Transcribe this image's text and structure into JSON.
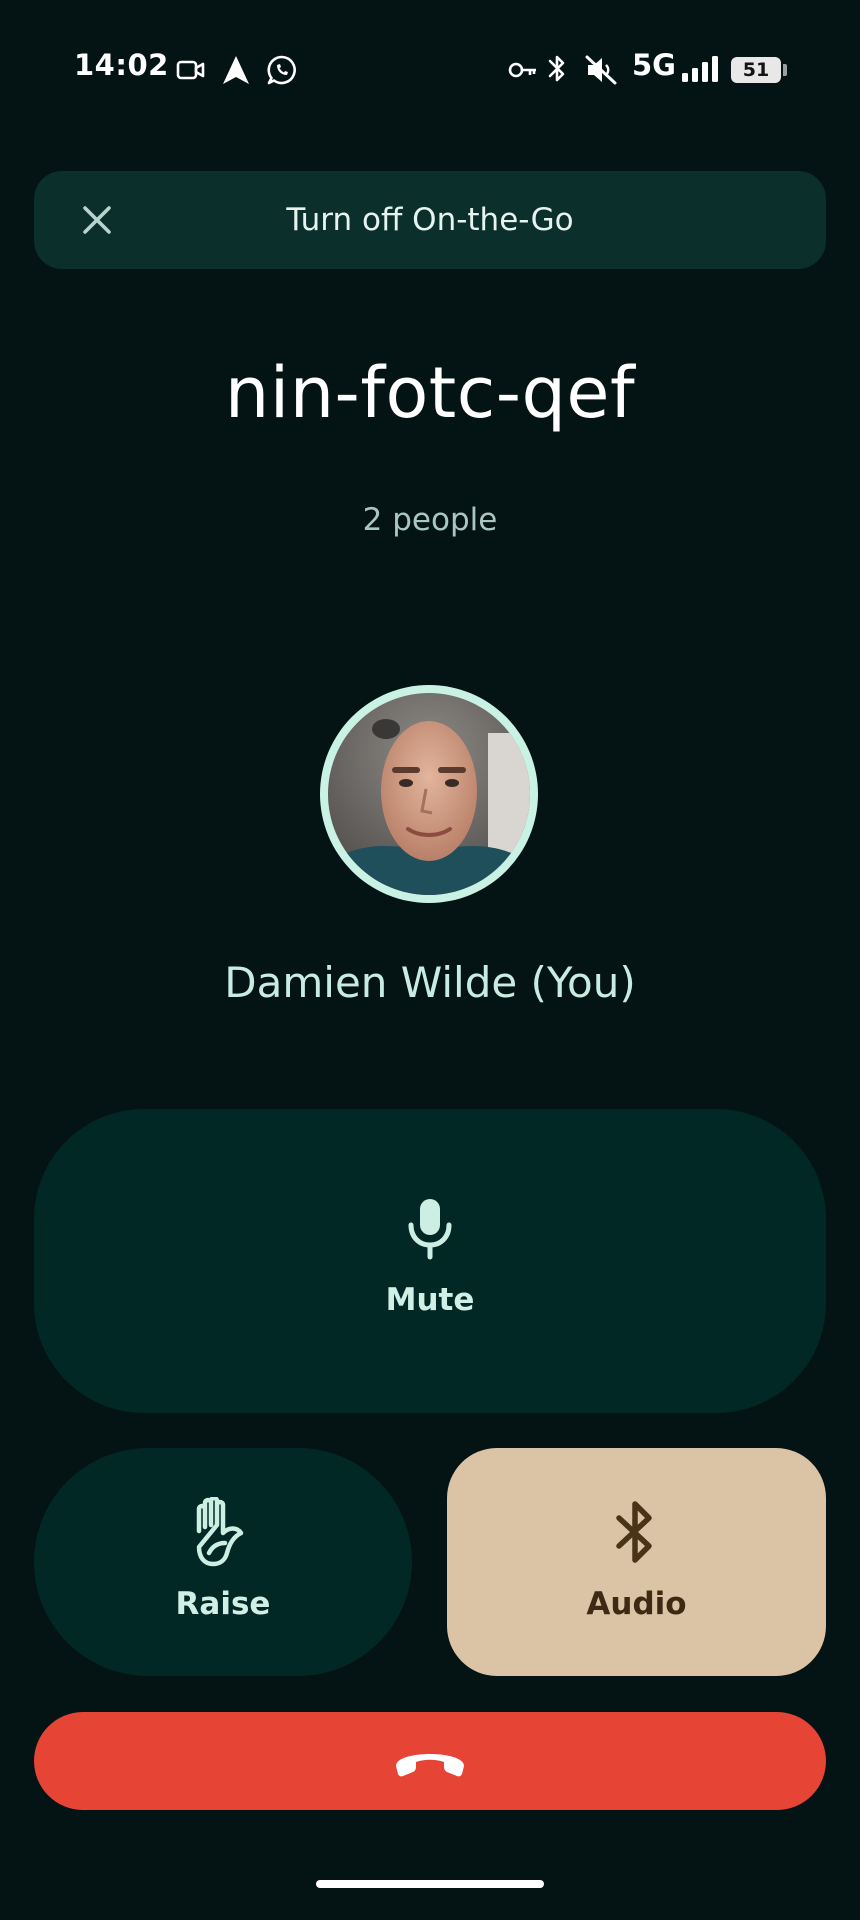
{
  "status_bar": {
    "time": "14:02",
    "left_icons": [
      "video-camera-icon",
      "navigation-arrow-icon",
      "whatsapp-icon"
    ],
    "right_icons": [
      "vpn-key-icon",
      "bluetooth-icon",
      "mute-icon",
      "signal-icon"
    ],
    "network": "5G",
    "battery": "51"
  },
  "banner": {
    "text": "Turn off On-the-Go",
    "close_icon": "close-icon"
  },
  "meeting": {
    "code": "nin-fotc-qef",
    "people_count": "2 people"
  },
  "participant": {
    "name": "Damien Wilde (You)"
  },
  "controls": {
    "mute_label": "Mute",
    "mute_icon": "microphone-icon",
    "raise_label": "Raise",
    "raise_icon": "raise-hand-icon",
    "audio_label": "Audio",
    "audio_icon": "bluetooth-icon",
    "end_call_icon": "end-call-icon"
  },
  "colors": {
    "background": "#041414",
    "button_dark": "#022825",
    "audio_active": "#dbc4a5",
    "end_call": "#e64536"
  }
}
